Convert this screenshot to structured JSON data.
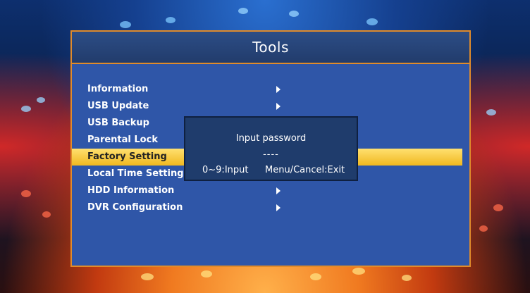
{
  "screen": {
    "title": "Tools",
    "menu": [
      {
        "label": "Information",
        "has_submenu": true,
        "selected": false
      },
      {
        "label": "USB Update",
        "has_submenu": true,
        "selected": false
      },
      {
        "label": "USB Backup",
        "has_submenu": false,
        "selected": false
      },
      {
        "label": "Parental Lock",
        "has_submenu": false,
        "selected": false
      },
      {
        "label": "Factory Setting",
        "has_submenu": false,
        "selected": true
      },
      {
        "label": "Local Time Setting",
        "has_submenu": false,
        "selected": false
      },
      {
        "label": "HDD Information",
        "has_submenu": true,
        "selected": false
      },
      {
        "label": "DVR Configuration",
        "has_submenu": true,
        "selected": false
      }
    ]
  },
  "dialog": {
    "title": "Input password",
    "mask": "----",
    "hint_input": "0~9:Input",
    "hint_exit": "Menu/Cancel:Exit"
  },
  "colors": {
    "panel": "#2f56a8",
    "border": "#e08b2a",
    "highlight": "#f0c030",
    "dialog": "#1f3c6c"
  }
}
